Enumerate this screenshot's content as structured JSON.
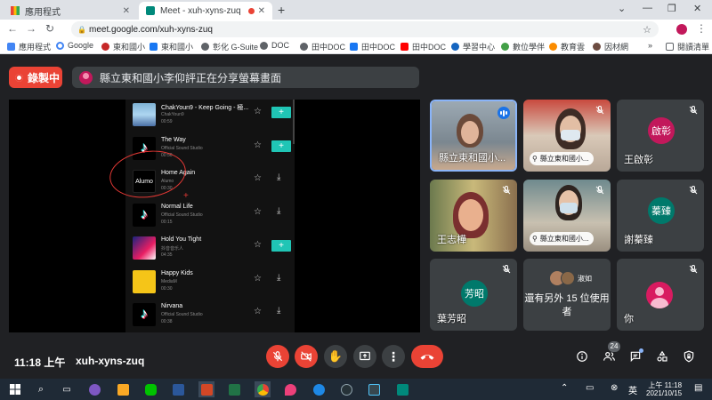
{
  "browser": {
    "tabs": [
      {
        "label": "應用程式",
        "active": false
      },
      {
        "label": "Meet - xuh-xyns-zuq",
        "active": true
      }
    ],
    "url": "meet.google.com/xuh-xyns-zuq",
    "bookmarks": [
      "應用程式",
      "Google",
      "東和國小",
      "東和國小",
      "彰化 G-Suite",
      "DOC",
      "田中DOC",
      "田中DOC",
      "田中DOC",
      "學習中心",
      "數位學伴",
      "教育雲",
      "因材網",
      "閱讀清單"
    ],
    "overflow": "»"
  },
  "meet": {
    "recording_label": "錄製中",
    "share_banner": "縣立東和國小李仰評正在分享螢幕畫面",
    "presentation": {
      "songs": [
        {
          "title": "ChakYoun9 - Keep Going - 極...",
          "artist": "ChakYoun9",
          "duration": "00:59",
          "thumb": "landscape",
          "action": "add"
        },
        {
          "title": "The Way",
          "artist": "Official Sound Studio",
          "duration": "00:50",
          "thumb": "tiktok",
          "action": "add"
        },
        {
          "title": "Home Again",
          "artist": "Alumo",
          "duration": "00:30",
          "thumb": "alumo",
          "action": "download"
        },
        {
          "title": "Normal Life",
          "artist": "Official Sound Studio",
          "duration": "00:15",
          "thumb": "tiktok",
          "action": "download"
        },
        {
          "title": "Hold You Tight",
          "artist": "抖音音乐人",
          "duration": "04:35",
          "thumb": "anime",
          "action": "add"
        },
        {
          "title": "Happy Kids",
          "artist": "MediaM",
          "duration": "00:30",
          "thumb": "yellow",
          "action": "download"
        },
        {
          "title": "Nirvana",
          "artist": "Official Sound Studio",
          "duration": "00:38",
          "thumb": "tiktok",
          "action": "download"
        }
      ],
      "thumb_text": "Alumo",
      "add_label": "+",
      "tiktok_glyph": "♪"
    },
    "participants": [
      {
        "name": "縣立東和國小...",
        "kind": "video",
        "speaking": true
      },
      {
        "name": "縣立東和國小...",
        "kind": "video",
        "muted": true,
        "pill": true
      },
      {
        "name": "王啟彰",
        "kind": "initials",
        "initials": "啟彰",
        "color": "#c2185b",
        "muted": true
      },
      {
        "name": "王志樺",
        "kind": "video",
        "muted": true
      },
      {
        "name": "縣立東和國小...",
        "kind": "video",
        "muted": true,
        "pill": true
      },
      {
        "name": "謝蓁臻",
        "kind": "initials",
        "initials": "蓁臻",
        "color": "#00796b",
        "muted": true
      },
      {
        "name": "葉芳昭",
        "kind": "initials",
        "initials": "芳昭",
        "color": "#00796b",
        "muted": true
      },
      {
        "name": "還有另外 15 位使用者",
        "kind": "others",
        "chip": "淑如"
      },
      {
        "name": "你",
        "kind": "self",
        "muted": true
      }
    ],
    "bottom": {
      "time": "11:18 上午",
      "meeting_code": "xuh-xyns-zuq",
      "participant_count": "24"
    }
  },
  "taskbar": {
    "time": "上午 11:18",
    "date": "2021/10/15"
  }
}
